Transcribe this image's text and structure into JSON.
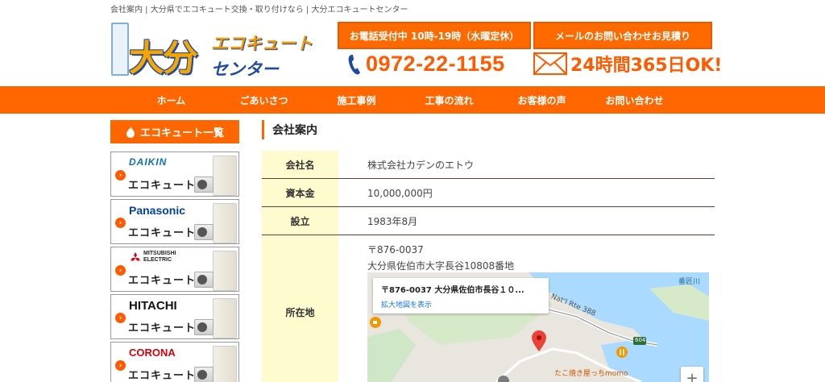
{
  "breadcrumb": "会社案内 | 大分県でエコキュート交換・取り付けなら | 大分エコキュートセンター",
  "logo": {
    "big": "大分",
    "top": "エコキュート",
    "bottom": "センター"
  },
  "header": {
    "hours_button": "お電話受付中 10時-19時（水曜定休）",
    "mail_button": "メールのお問い合わせお見積り",
    "phone": "0972-22-1155",
    "mail_text": "24時間365日OK!"
  },
  "nav": [
    "ホーム",
    "ごあいさつ",
    "施工事例",
    "工事の流れ",
    "お客様の声",
    "お問い合わせ"
  ],
  "sidebar": {
    "heading": "エコキュート一覧",
    "brands": [
      {
        "name": "DAIKIN",
        "label": "エコキュート"
      },
      {
        "name": "Panasonic",
        "label": "エコキュート"
      },
      {
        "name": "MITSUBISHI ELECTRIC",
        "label": "エコキュート"
      },
      {
        "name": "HITACHI",
        "label": "エコキュート"
      },
      {
        "name": "CORONA",
        "label": "エコキュート"
      }
    ]
  },
  "main": {
    "title": "会社案内",
    "rows": [
      {
        "label": "会社名",
        "value": "株式会社カデンのエトウ"
      },
      {
        "label": "資本金",
        "value": "10,000,000円"
      },
      {
        "label": "設立",
        "value": "1983年8月"
      }
    ],
    "address": {
      "label": "所在地",
      "postal": "〒876-0037",
      "line": "大分県佐伯市大字長谷10808番地"
    }
  },
  "map": {
    "popup_title": "〒876-0037 大分県佐伯市長谷１０...",
    "popup_link": "拡大地図を表示",
    "place_label": "たこ焼き屋っちmomo",
    "river_label": "番匠川",
    "route_label": "Nat'l Rte 388",
    "route_number": "604",
    "zoom_in": "+"
  },
  "colors": {
    "accent": "#ff6600",
    "table_header": "#fefccf",
    "row_border": "#5c4033",
    "link": "#1a73e8"
  }
}
